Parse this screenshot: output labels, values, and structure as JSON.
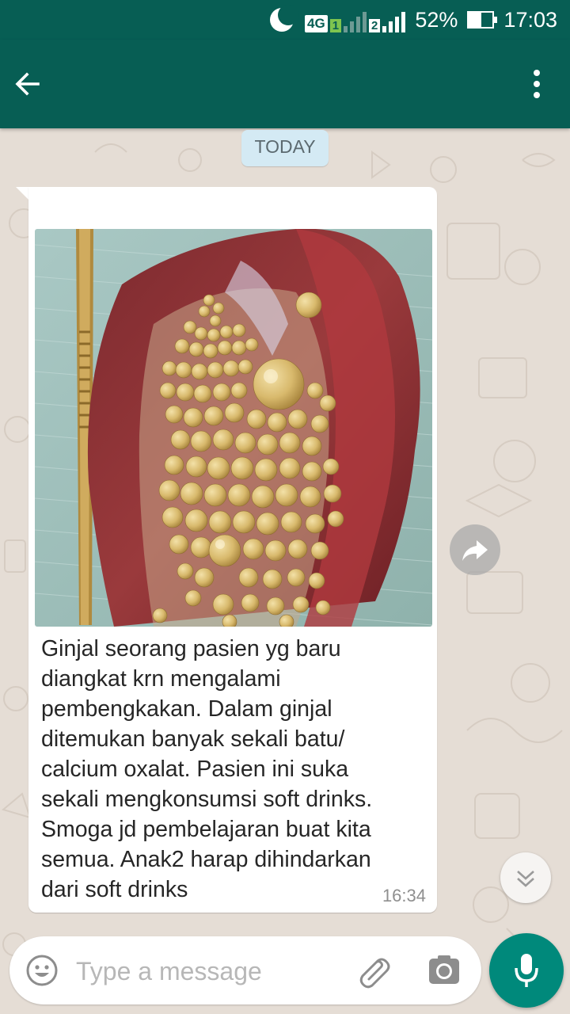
{
  "status_bar": {
    "network": "4G",
    "sim1": "1",
    "sim2": "2",
    "battery": "52%",
    "battery_level": 0.52,
    "time": "17:03"
  },
  "chat": {
    "date_chip": "TODAY",
    "message": {
      "text": "Ginjal seorang pasien yg baru\ndiangkat krn mengalami\npembengkakan. Dalam ginjal\nditemukan banyak sekali batu/\ncalcium oxalat. Pasien ini suka\nsekali mengkonsumsi soft drinks.\nSmoga jd pembelajaran buat kita\nsemua. Anak2 harap dihindarkan\ndari soft drinks",
      "time": "16:34"
    }
  },
  "input": {
    "placeholder": "Type a message"
  },
  "colors": {
    "header": "#075e54",
    "wallpaper": "#e5ddd5",
    "mic": "#00897b"
  },
  "icons": [
    "moon-icon",
    "back-arrow-icon",
    "more-vert-icon",
    "forward-icon",
    "chevron-double-down-icon",
    "emoji-icon",
    "attach-icon",
    "camera-icon",
    "mic-icon"
  ]
}
